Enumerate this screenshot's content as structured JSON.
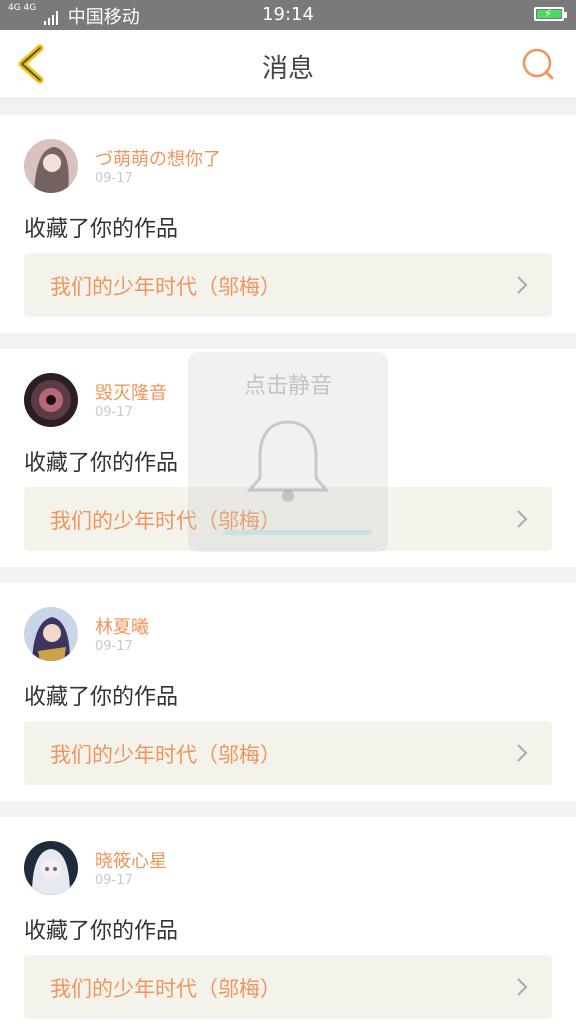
{
  "status_bar": {
    "network": "4G 4G",
    "carrier": "中国移动",
    "time": "19:14"
  },
  "header": {
    "title": "消息",
    "back_icon": "chevron-left-icon",
    "search_icon": "search-icon",
    "accent_color": "#f0955c"
  },
  "messages": [
    {
      "username": "づ萌萌の想你了",
      "date": "09-17",
      "action": "收藏了你的作品",
      "work_title": "我们的少年时代（邬梅）"
    },
    {
      "username": "毁灭隆音",
      "date": "09-17",
      "action": "收藏了你的作品",
      "work_title": "我们的少年时代（邬梅）"
    },
    {
      "username": "林夏曦",
      "date": "09-17",
      "action": "收藏了你的作品",
      "work_title": "我们的少年时代（邬梅）"
    },
    {
      "username": "晓筱心星",
      "date": "09-17",
      "action": "收藏了你的作品",
      "work_title": "我们的少年时代（邬梅）"
    }
  ],
  "toast": {
    "text": "点击静音",
    "icon": "bell-icon"
  }
}
